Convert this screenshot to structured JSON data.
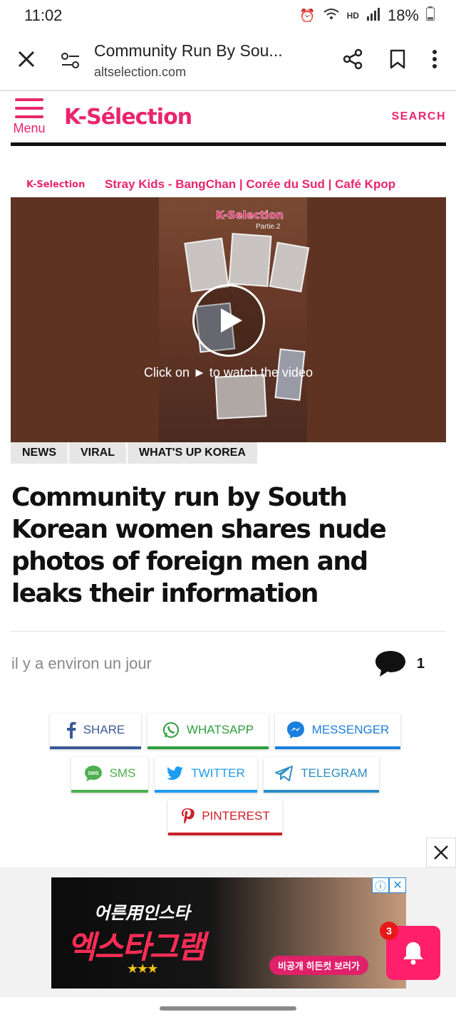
{
  "status_bar": {
    "time": "11:02",
    "battery": "18%",
    "network": "HD"
  },
  "browser": {
    "title": "Community Run By Sou...",
    "url": "altselection.com"
  },
  "site_header": {
    "menu_label": "Menu",
    "logo": "K-Sélection",
    "search_label": "SEARCH"
  },
  "video": {
    "brand": "K-Selection",
    "heading": "Stray Kids - BangChan | Corée du Sud | Café Kpop",
    "overlay_logo": "K-Selection",
    "overlay_sub": "Partie.2",
    "hint": "Click on ► to watch the video"
  },
  "categories": [
    "NEWS",
    "VIRAL",
    "WHAT'S UP KOREA"
  ],
  "article": {
    "title": "Community run by South Korean women shares nude photos of foreign men and leaks their information",
    "date": "il y a environ un jour",
    "comment_count": "1"
  },
  "share": {
    "facebook": "SHARE",
    "whatsapp": "WHATSAPP",
    "messenger": "MESSENGER",
    "sms": "SMS",
    "twitter": "TWITTER",
    "telegram": "TELEGRAM",
    "pinterest": "PINTEREST"
  },
  "colors": {
    "brand": "#e8266b",
    "facebook": "#3b5998",
    "whatsapp": "#2e9e3b",
    "messenger": "#1b7fde",
    "sms": "#4caf50",
    "twitter": "#1d9bf0",
    "telegram": "#2c8ec5",
    "pinterest": "#cb2027"
  },
  "ad": {
    "line1": "어른用인스타",
    "line2": "엑스타그램",
    "stars": "★★★",
    "cta": "비공개 히든컷 보러가",
    "notification_count": "3"
  }
}
